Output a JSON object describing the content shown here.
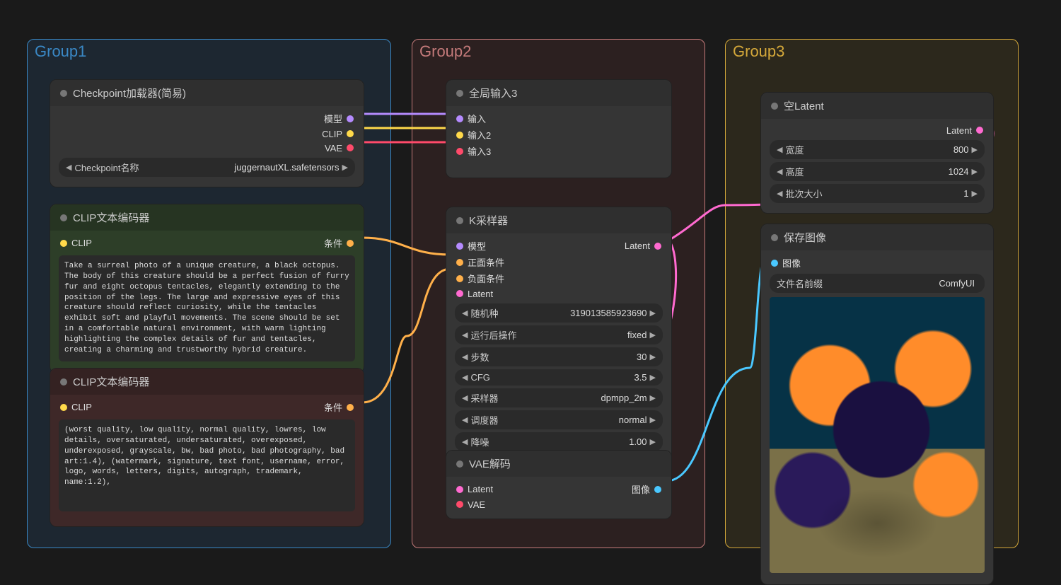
{
  "groups": {
    "g1": "Group1",
    "g2": "Group2",
    "g3": "Group3"
  },
  "ckpt": {
    "title": "Checkpoint加载器(简易)",
    "out_model": "模型",
    "out_clip": "CLIP",
    "out_vae": "VAE",
    "w_name_label": "Checkpoint名称",
    "w_name_value": "juggernautXL.safetensors"
  },
  "clip_pos": {
    "title": "CLIP文本编码器",
    "in_clip": "CLIP",
    "out_cond": "条件",
    "text": "Take a surreal photo of a unique creature, a black octopus. The body of this creature should be a perfect fusion of furry fur and eight octopus tentacles, elegantly extending to the position of the legs. The large and expressive eyes of this creature should reflect curiosity, while the tentacles exhibit soft and playful movements. The scene should be set in a comfortable natural environment, with warm lighting highlighting the complex details of fur and tentacles, creating a charming and trustworthy hybrid creature."
  },
  "clip_neg": {
    "title": "CLIP文本编码器",
    "in_clip": "CLIP",
    "out_cond": "条件",
    "text": "(worst quality, low quality, normal quality, lowres, low details, oversaturated, undersaturated, overexposed, underexposed, grayscale, bw, bad photo, bad photography, bad art:1.4), (watermark, signature, text font, username, error, logo, words, letters, digits, autograph, trademark, name:1.2),"
  },
  "global_in": {
    "title": "全局输入3",
    "in1": "输入",
    "in2": "输入2",
    "in3": "输入3"
  },
  "ksampler": {
    "title": "K采样器",
    "in_model": "模型",
    "in_pos": "正面条件",
    "in_neg": "负面条件",
    "in_latent": "Latent",
    "out_latent": "Latent",
    "seed_label": "随机种",
    "seed_value": "319013585923690",
    "after_label": "运行后操作",
    "after_value": "fixed",
    "steps_label": "步数",
    "steps_value": "30",
    "cfg_label": "CFG",
    "cfg_value": "3.5",
    "sampler_label": "采样器",
    "sampler_value": "dpmpp_2m",
    "sched_label": "调度器",
    "sched_value": "normal",
    "denoise_label": "降噪",
    "denoise_value": "1.00"
  },
  "vae_decode": {
    "title": "VAE解码",
    "in_latent": "Latent",
    "in_vae": "VAE",
    "out_image": "图像"
  },
  "empty_latent": {
    "title": "空Latent",
    "out_latent": "Latent",
    "w_label": "宽度",
    "w_value": "800",
    "h_label": "高度",
    "h_value": "1024",
    "b_label": "批次大小",
    "b_value": "1"
  },
  "save_image": {
    "title": "保存图像",
    "in_image": "图像",
    "prefix_label": "文件名前缀",
    "prefix_value": "ComfyUI"
  }
}
